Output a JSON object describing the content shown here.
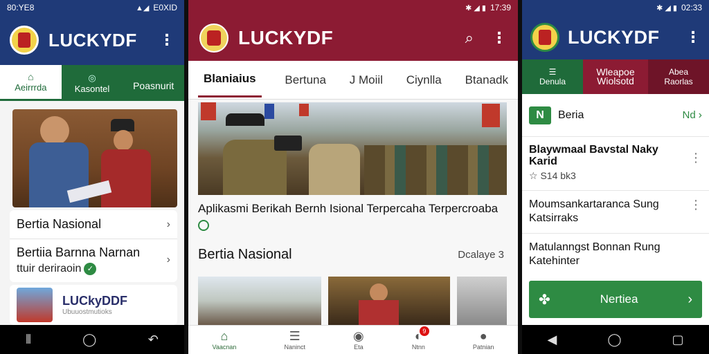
{
  "phone1": {
    "status_time": "80:YE8",
    "status_right": "E0XID",
    "title": "LUCKYDF",
    "tabs": [
      {
        "label": "Aeirrrda",
        "icon": "home-icon"
      },
      {
        "label": "Kasontel",
        "icon": "sync-icon"
      },
      {
        "label": "Poasnurit",
        "icon": ""
      }
    ],
    "list": [
      {
        "text": "Bertia Nasional"
      },
      {
        "text": "Bertiia Barnna Narnan",
        "subtext": "ttuir deriraoin"
      }
    ],
    "ad": {
      "title": "LUCkyDDF",
      "subtitle": "Ubuuostmutioks"
    }
  },
  "phone2": {
    "status_time": "17:39",
    "title": "LUCKYDF",
    "tabs": [
      "Blaniaius",
      "Bertuna",
      "J Moiil",
      "Ciynlla",
      "Btanadk"
    ],
    "hero_caption": "Aplikasmi Berikah Bernh Isional Terpercaha Terpercroaba",
    "section_title": "Bertia Nasional",
    "section_more": "Dcalaye 3",
    "badge_count": "9",
    "bottom_nav": [
      {
        "label": "Vaacnan",
        "icon": "home-icon"
      },
      {
        "label": "Naninct",
        "icon": "list-icon"
      },
      {
        "label": "Eta",
        "icon": "compass-icon"
      },
      {
        "label": "Ntnn",
        "icon": "notification-icon"
      },
      {
        "label": "Patnian",
        "icon": "profile-icon"
      }
    ]
  },
  "phone3": {
    "status_time": "02:33",
    "title": "LUCKYDF",
    "tabs": [
      {
        "label": "Denula",
        "icon": "list-icon"
      },
      {
        "label": "Wleapoe Wiolsotd",
        "icon": ""
      },
      {
        "label": "Abea Raorlas",
        "icon": ""
      }
    ],
    "header_label": "Beria",
    "header_action": "Nd",
    "items": [
      {
        "title": "Blaywmaal Bavstal Naky Karid",
        "meta": "S14 bk3"
      },
      {
        "title": "Moumsankartaranca Sung Katsirraks"
      },
      {
        "title": "Matulanngst Bonnan Rung Katehinter"
      }
    ],
    "button_label": "Nertiea"
  },
  "colors": {
    "navy": "#1f3a78",
    "maroon": "#8c1b33",
    "green": "#1f6b3a",
    "button_green": "#2e8b43"
  }
}
